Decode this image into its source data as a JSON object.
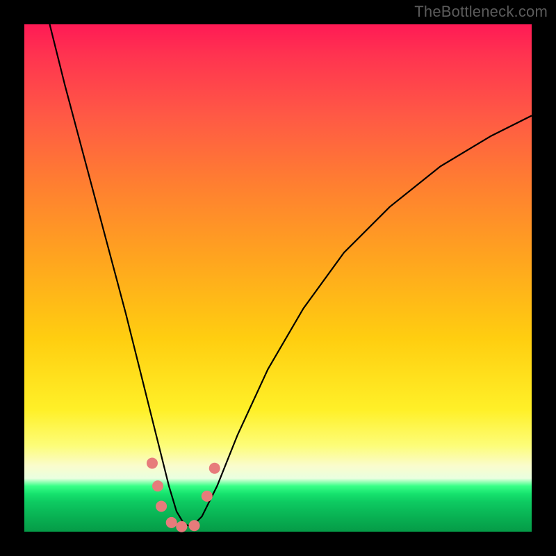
{
  "watermark": "TheBottleneck.com",
  "chart_data": {
    "type": "line",
    "title": "",
    "xlabel": "",
    "ylabel": "",
    "xlim": [
      0,
      100
    ],
    "ylim": [
      0,
      100
    ],
    "background_gradient": {
      "top_color": "#ff1a55",
      "mid_color": "#fff028",
      "bottom_color": "#059b47"
    },
    "series": [
      {
        "name": "bottleneck-curve",
        "color": "#000000",
        "x": [
          5,
          8,
          12,
          16,
          20,
          23,
          25,
          27,
          28.5,
          30,
          31.5,
          33,
          35,
          38,
          42,
          48,
          55,
          63,
          72,
          82,
          92,
          100
        ],
        "y": [
          100,
          88,
          73,
          58,
          43,
          31,
          23,
          15,
          9,
          4,
          1.5,
          1,
          3,
          9,
          19,
          32,
          44,
          55,
          64,
          72,
          78,
          82
        ]
      }
    ],
    "markers": [
      {
        "name": "data-points",
        "color": "#e77b7b",
        "radius": 8,
        "points": [
          {
            "x": 25.2,
            "y": 13.5
          },
          {
            "x": 26.3,
            "y": 9.0
          },
          {
            "x": 27.0,
            "y": 5.0
          },
          {
            "x": 29.0,
            "y": 1.8
          },
          {
            "x": 31.0,
            "y": 1.0
          },
          {
            "x": 33.5,
            "y": 1.2
          },
          {
            "x": 36.0,
            "y": 7.0
          },
          {
            "x": 37.5,
            "y": 12.5
          }
        ]
      }
    ]
  }
}
